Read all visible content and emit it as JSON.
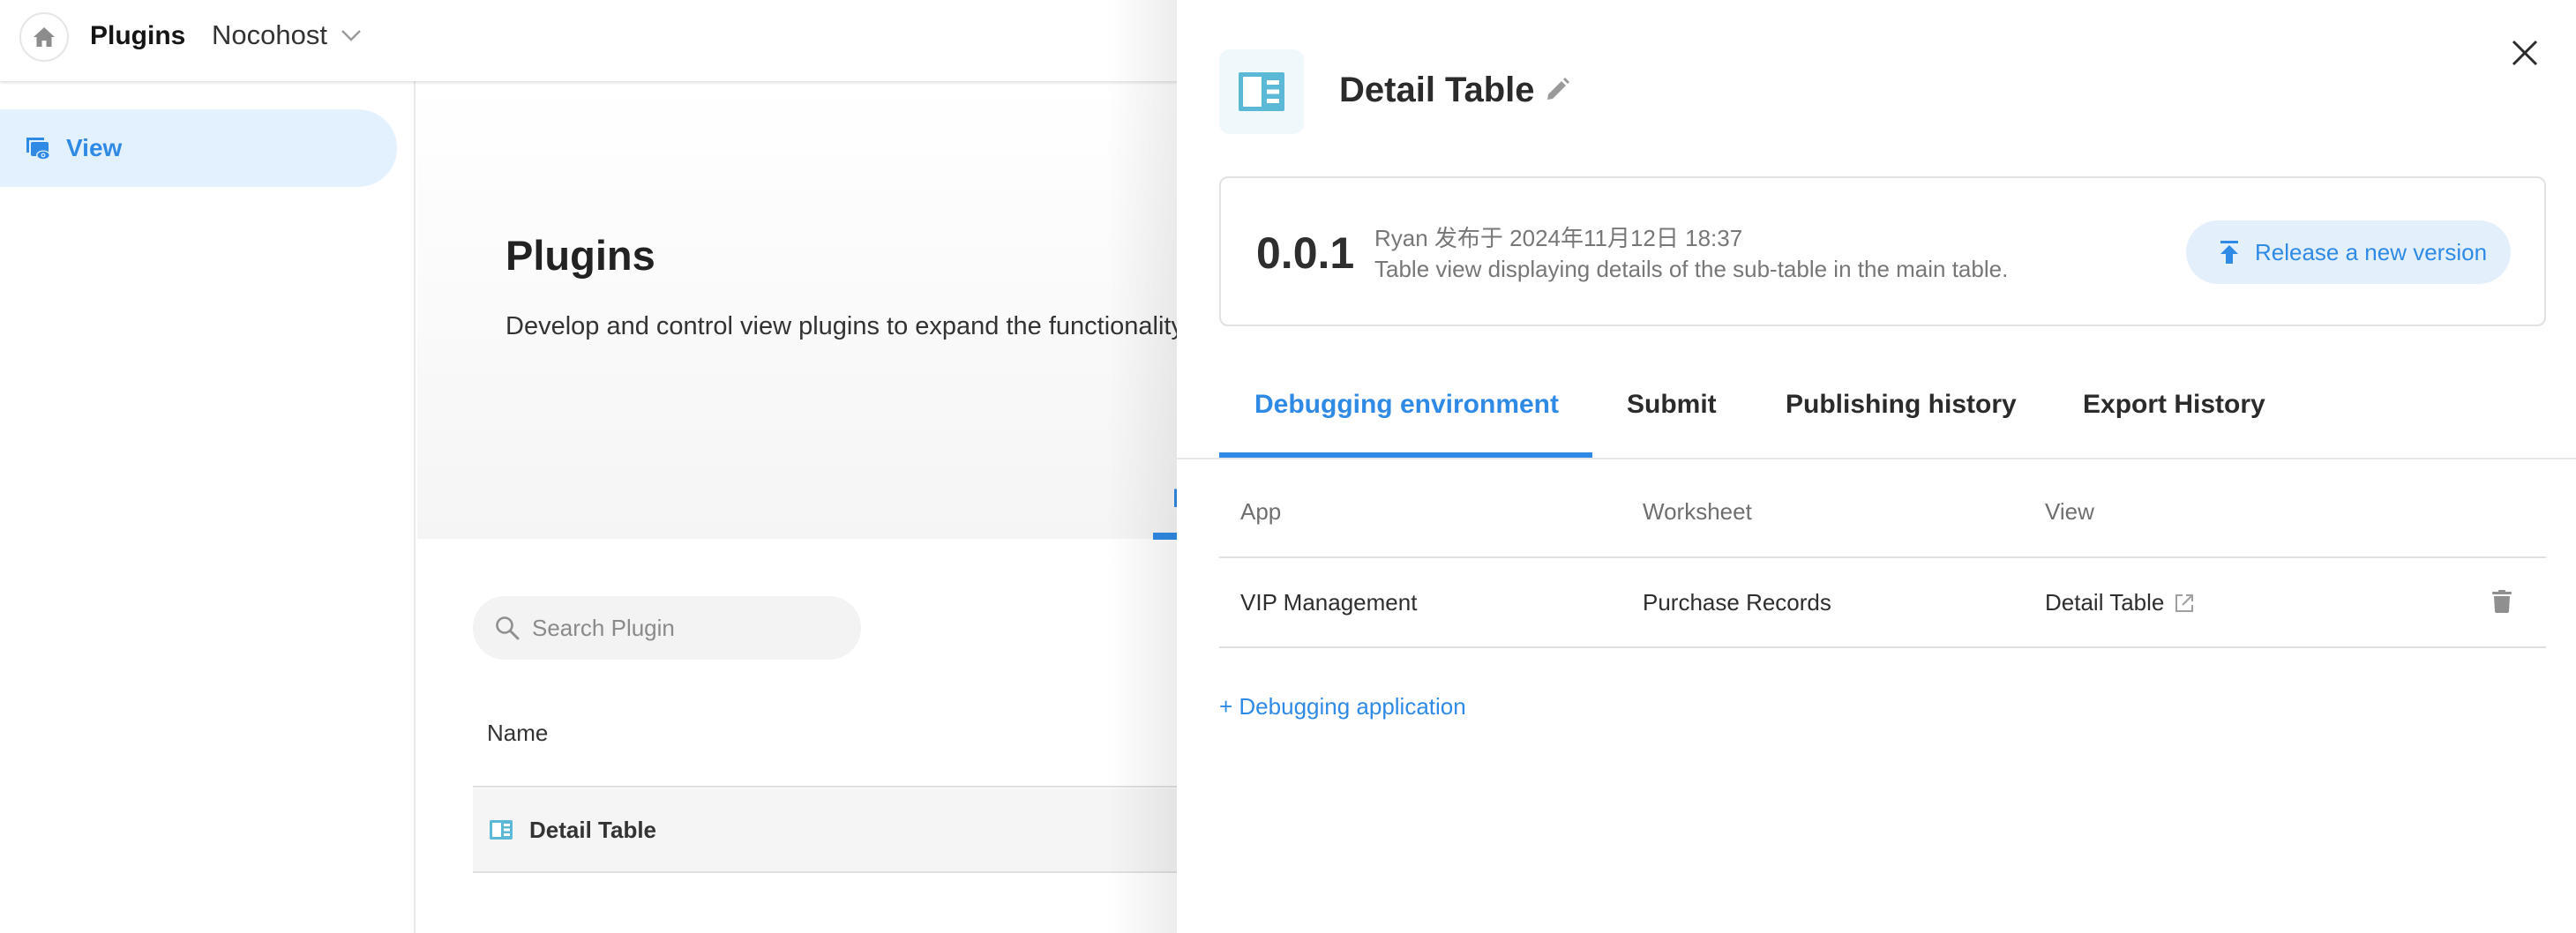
{
  "header": {
    "title": "Plugins",
    "org_name": "Nocohost",
    "icons": {
      "home": "home-icon",
      "org_dropdown": "chevron-down-icon"
    }
  },
  "sidebar": {
    "items": [
      {
        "label": "View",
        "icon": "view-plugin-icon",
        "active": true
      }
    ]
  },
  "main": {
    "title": "Plugins",
    "description": "Develop and control view plugins to expand the functionality of your views",
    "background_tab_label": "I",
    "search": {
      "placeholder": "Search Plugin",
      "value": ""
    },
    "plugin_list": {
      "columns": [
        "Name"
      ],
      "rows": [
        {
          "name": "Detail Table",
          "icon": "detail-table-icon"
        }
      ]
    }
  },
  "drawer": {
    "title": "Detail Table",
    "icon": "detail-table-icon",
    "version_card": {
      "version": "0.0.1",
      "meta": "Ryan 发布于 2024年11月12日 18:37",
      "description": "Table view displaying details of the sub-table in the main table.",
      "release_button_label": "Release a new version"
    },
    "tabs": [
      {
        "label": "Debugging environment",
        "active": true
      },
      {
        "label": "Submit",
        "active": false
      },
      {
        "label": "Publishing history",
        "active": false
      },
      {
        "label": "Export History",
        "active": false
      }
    ],
    "debug_table": {
      "columns": [
        "App",
        "Worksheet",
        "View"
      ],
      "rows": [
        {
          "app": "VIP Management",
          "worksheet": "Purchase Records",
          "view": "Detail Table"
        }
      ]
    },
    "add_debug_label": "+ Debugging application"
  },
  "colors": {
    "accent": "#2f8ae5",
    "accent_bg": "#e3f0fc",
    "plugin_icon": "#5bb8d6",
    "text_primary": "#2b2b2b",
    "text_secondary": "#777777",
    "divider": "#e0e0e0"
  }
}
